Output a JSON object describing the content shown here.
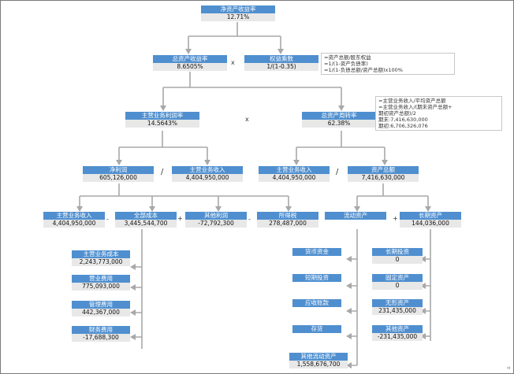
{
  "nodes": {
    "roe": {
      "label": "净资产收益率",
      "value": "12.71%"
    },
    "roa": {
      "label": "总资产收益率",
      "value": "8.6505%"
    },
    "equity_multiplier": {
      "label": "权益乘数",
      "value": "1/(1-0.35)"
    },
    "profit_margin": {
      "label": "主营业务利润率",
      "value": "14.5643%"
    },
    "asset_turnover": {
      "label": "总资产周转率",
      "value": "62.38%"
    },
    "net_profit": {
      "label": "净利润",
      "value": "605,126,000"
    },
    "revenue_a": {
      "label": "主营业务收入",
      "value": "4,404,950,000"
    },
    "revenue_b": {
      "label": "主营业务收入",
      "value": "4,404,950,000"
    },
    "total_assets": {
      "label": "资产总额",
      "value": "7,416,630,000"
    },
    "revenue_c": {
      "label": "主营业务收入",
      "value": "4,404,950,000"
    },
    "total_cost": {
      "label": "全部成本",
      "value": "3,445,544,700"
    },
    "other_profit": {
      "label": "其他利润",
      "value": "-72,792,300"
    },
    "income_tax": {
      "label": "所得税",
      "value": "278,487,000"
    },
    "current_assets": {
      "label": "流动资产",
      "value": ""
    },
    "long_term_assets": {
      "label": "长期资产",
      "value": "144,036,000"
    },
    "cost_of_sales": {
      "label": "主营业务成本",
      "value": "2,243,773,000"
    },
    "selling_expense": {
      "label": "营业费用",
      "value": "775,093,000"
    },
    "admin_expense": {
      "label": "管理费用",
      "value": "442,367,000"
    },
    "finance_expense": {
      "label": "财务费用",
      "value": "-17,688,300"
    },
    "cash": {
      "label": "货币资金",
      "value": ""
    },
    "short_investments": {
      "label": "短期投资",
      "value": ""
    },
    "receivables": {
      "label": "应收账款",
      "value": ""
    },
    "inventory": {
      "label": "存货",
      "value": ""
    },
    "other_current": {
      "label": "其他流动资产",
      "value": "1,558,676,700"
    },
    "long_investments": {
      "label": "长期投资",
      "value": "0"
    },
    "fixed_assets": {
      "label": "固定资产",
      "value": "0"
    },
    "intangible_assets": {
      "label": "无形资产",
      "value": "231,435,000"
    },
    "other_assets": {
      "label": "其他资产",
      "value": "-231,435,000"
    }
  },
  "operators": {
    "times_1": "x",
    "times_2": "x",
    "divide_1": "/",
    "divide_2": "/",
    "minus_1": "-",
    "plus_1": "+",
    "minus_2": "-",
    "plus_2": "+"
  },
  "notes": {
    "equity_note": [
      "=资产总额/股东权益",
      "=1/(1-资产负债率)",
      "=1/(1-负债总额/资产总额)x100%"
    ],
    "turnover_note": [
      "=主营业务收入/平均资产总额",
      "=主营业务收入/(期末资产总额+",
      "期初资产总额)/2",
      "期末:7,416,630,000",
      "期初:6,706,326,076"
    ]
  },
  "colors": {
    "label_fill": "#4f8fcf",
    "value_fill": "#e8e8e8",
    "connector": "#a8a8a8"
  }
}
